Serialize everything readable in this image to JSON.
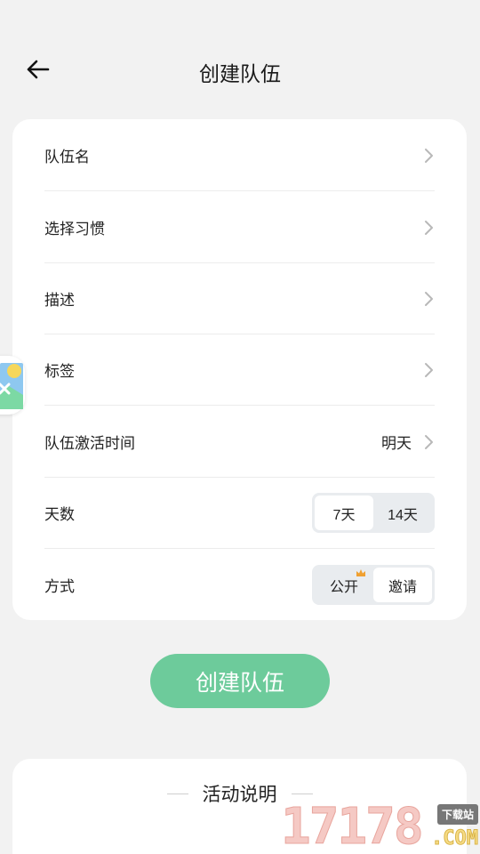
{
  "header": {
    "title": "创建队伍"
  },
  "rows": [
    {
      "label": "队伍名"
    },
    {
      "label": "选择习惯"
    },
    {
      "label": "描述"
    },
    {
      "label": "标签"
    },
    {
      "label": "队伍激活时间",
      "value": "明天"
    }
  ],
  "days": {
    "label": "天数",
    "options": [
      "7天",
      "14天"
    ],
    "selected": "7天"
  },
  "mode": {
    "label": "方式",
    "options": [
      "公开",
      "邀请"
    ],
    "selected": "邀请"
  },
  "create_button": {
    "label": "创建队伍"
  },
  "info": {
    "title": "活动说明"
  },
  "watermark": {
    "number": "17178",
    "tag": "下载站",
    "domain": ".COM"
  },
  "colors": {
    "accent": "#6dcb9b",
    "background": "#f2f2f2",
    "card": "#ffffff"
  },
  "icons": {
    "back": "arrow-left-icon",
    "chevron": "chevron-right-icon",
    "crown": "crown-icon",
    "float": "image-icon"
  }
}
